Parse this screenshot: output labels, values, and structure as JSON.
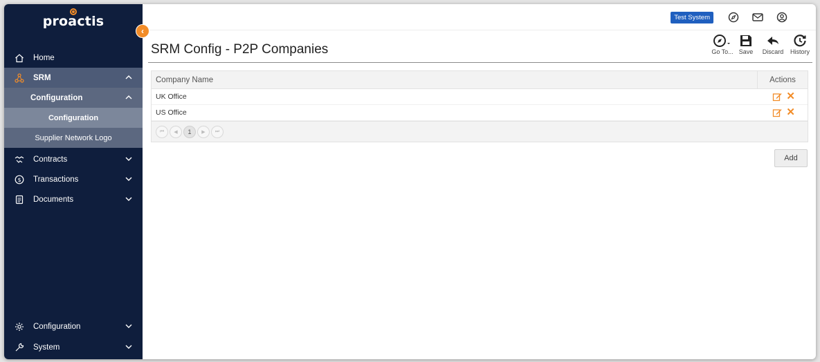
{
  "app": {
    "logo_text": "proactis",
    "test_badge": "Test System"
  },
  "sidebar": {
    "items": [
      {
        "label": "Home"
      },
      {
        "label": "SRM"
      },
      {
        "label": "Configuration"
      },
      {
        "label": "Configuration"
      },
      {
        "label": "Supplier Network Logo"
      },
      {
        "label": "Contracts"
      },
      {
        "label": "Transactions"
      },
      {
        "label": "Documents"
      },
      {
        "label": "Configuration"
      },
      {
        "label": "System"
      }
    ]
  },
  "header": {
    "title": "SRM Config - P2P Companies"
  },
  "toolbar": {
    "goto_label": "Go To...",
    "save_label": "Save",
    "discard_label": "Discard",
    "history_label": "History"
  },
  "table": {
    "columns": [
      "Company Name",
      "Actions"
    ],
    "rows": [
      {
        "name": "UK Office"
      },
      {
        "name": "US Office"
      }
    ],
    "pager": {
      "current_page": "1"
    }
  },
  "actions": {
    "add_label": "Add"
  },
  "colors": {
    "sidebar_bg": "#0f1e3d",
    "accent": "#f28c28",
    "badge": "#1f5fbf"
  }
}
